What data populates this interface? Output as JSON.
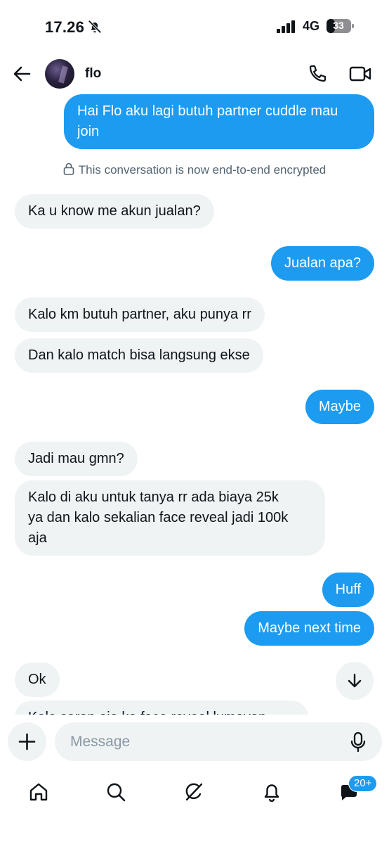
{
  "status_bar": {
    "time": "17.26",
    "network": "4G",
    "battery": "33"
  },
  "header": {
    "contact_name": "flo"
  },
  "messages": {
    "m1": "Hai Flo aku lagi butuh partner cuddle mau\njoin",
    "encryption_notice": "This conversation is now end-to-end encrypted",
    "m2": "Ka u know me akun jualan?",
    "m3": "Jualan apa?",
    "m4": "Kalo km butuh partner, aku punya rr",
    "m5": "Dan kalo match bisa langsung ekse",
    "m6": "Maybe",
    "m7": "Jadi mau gmn?",
    "m8": "Kalo di aku untuk tanya rr ada biaya 25k\nya dan kalo sekalian face reveal jadi 100k\naja",
    "m9": "Huff",
    "m10": "Maybe next time",
    "m11": "Ok",
    "m12": "Kalo saran aja ka face reveal lumayan"
  },
  "composer": {
    "placeholder": "Message"
  },
  "tab_bar": {
    "messages_badge": "20+"
  },
  "colors": {
    "accent": "#1d9bf0",
    "incoming_bubble": "#eff3f4",
    "text": "#0f1419"
  }
}
